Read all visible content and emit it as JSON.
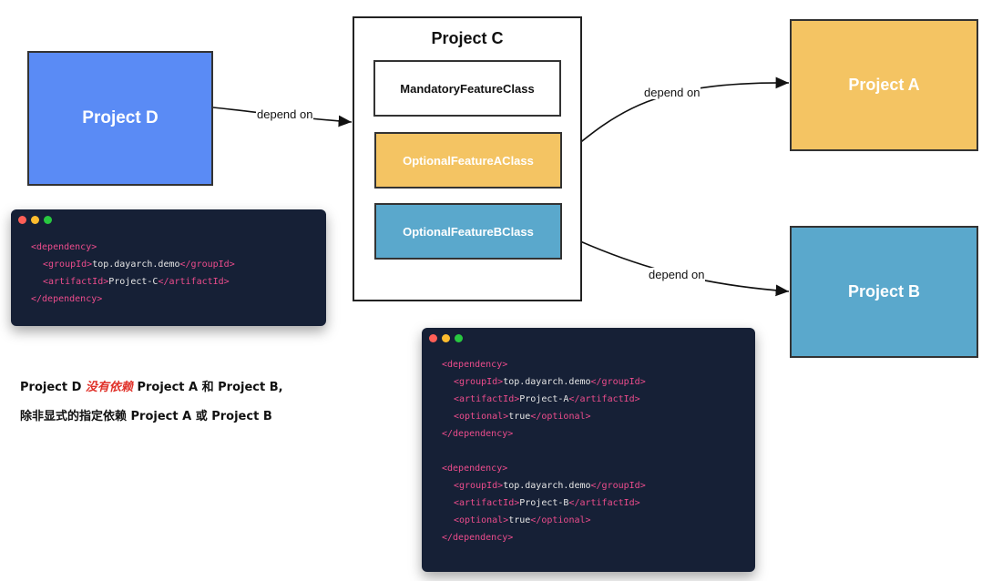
{
  "diagram": {
    "project_d": "Project D",
    "project_c": "Project C",
    "project_a": "Project A",
    "project_b": "Project B",
    "classes": {
      "mandatory": "MandatoryFeatureClass",
      "optional_a": "OptionalFeatureAClass",
      "optional_b": "OptionalFeatureBClass"
    },
    "edges": {
      "d_to_c": "depend on",
      "a_class_to_a": "depend on",
      "b_class_to_b": "depend on"
    },
    "colors": {
      "project_d": "#5a8bf5",
      "project_a": "#f4c463",
      "project_b": "#5aa8cc",
      "code_bg": "#162036",
      "tag": "#ec4c8c",
      "emphasis": "#e0322a"
    }
  },
  "code_blocks": [
    {
      "lines": [
        {
          "open": "<dependency>",
          "value": "",
          "close": "",
          "indent": 0
        },
        {
          "open": "<groupId>",
          "value": "top.dayarch.demo",
          "close": "</groupId>",
          "indent": 1
        },
        {
          "open": "<artifactId>",
          "value": "Project-C",
          "close": "</artifactId>",
          "indent": 1
        },
        {
          "open": "</dependency>",
          "value": "",
          "close": "",
          "indent": 0
        }
      ]
    },
    {
      "lines": [
        {
          "open": "<dependency>",
          "value": "",
          "close": "",
          "indent": 0
        },
        {
          "open": "<groupId>",
          "value": "top.dayarch.demo",
          "close": "</groupId>",
          "indent": 1
        },
        {
          "open": "<artifactId>",
          "value": "Project-A",
          "close": "</artifactId>",
          "indent": 1
        },
        {
          "open": "<optional>",
          "value": "true",
          "close": "</optional>",
          "indent": 1
        },
        {
          "open": "</dependency>",
          "value": "",
          "close": "",
          "indent": 0
        },
        {
          "open": "",
          "value": "",
          "close": "",
          "indent": 0
        },
        {
          "open": "<dependency>",
          "value": "",
          "close": "",
          "indent": 0
        },
        {
          "open": "<groupId>",
          "value": "top.dayarch.demo",
          "close": "</groupId>",
          "indent": 1
        },
        {
          "open": "<artifactId>",
          "value": "Project-B",
          "close": "</artifactId>",
          "indent": 1
        },
        {
          "open": "<optional>",
          "value": "true",
          "close": "</optional>",
          "indent": 1
        },
        {
          "open": "</dependency>",
          "value": "",
          "close": "",
          "indent": 0
        }
      ]
    }
  ],
  "notes": {
    "line1": {
      "prefix": "Project D ",
      "emphasis": "没有依赖",
      "suffix": " Project A 和 Project B,"
    },
    "line2": "除非显式的指定依赖 Project A 或 Project B"
  }
}
